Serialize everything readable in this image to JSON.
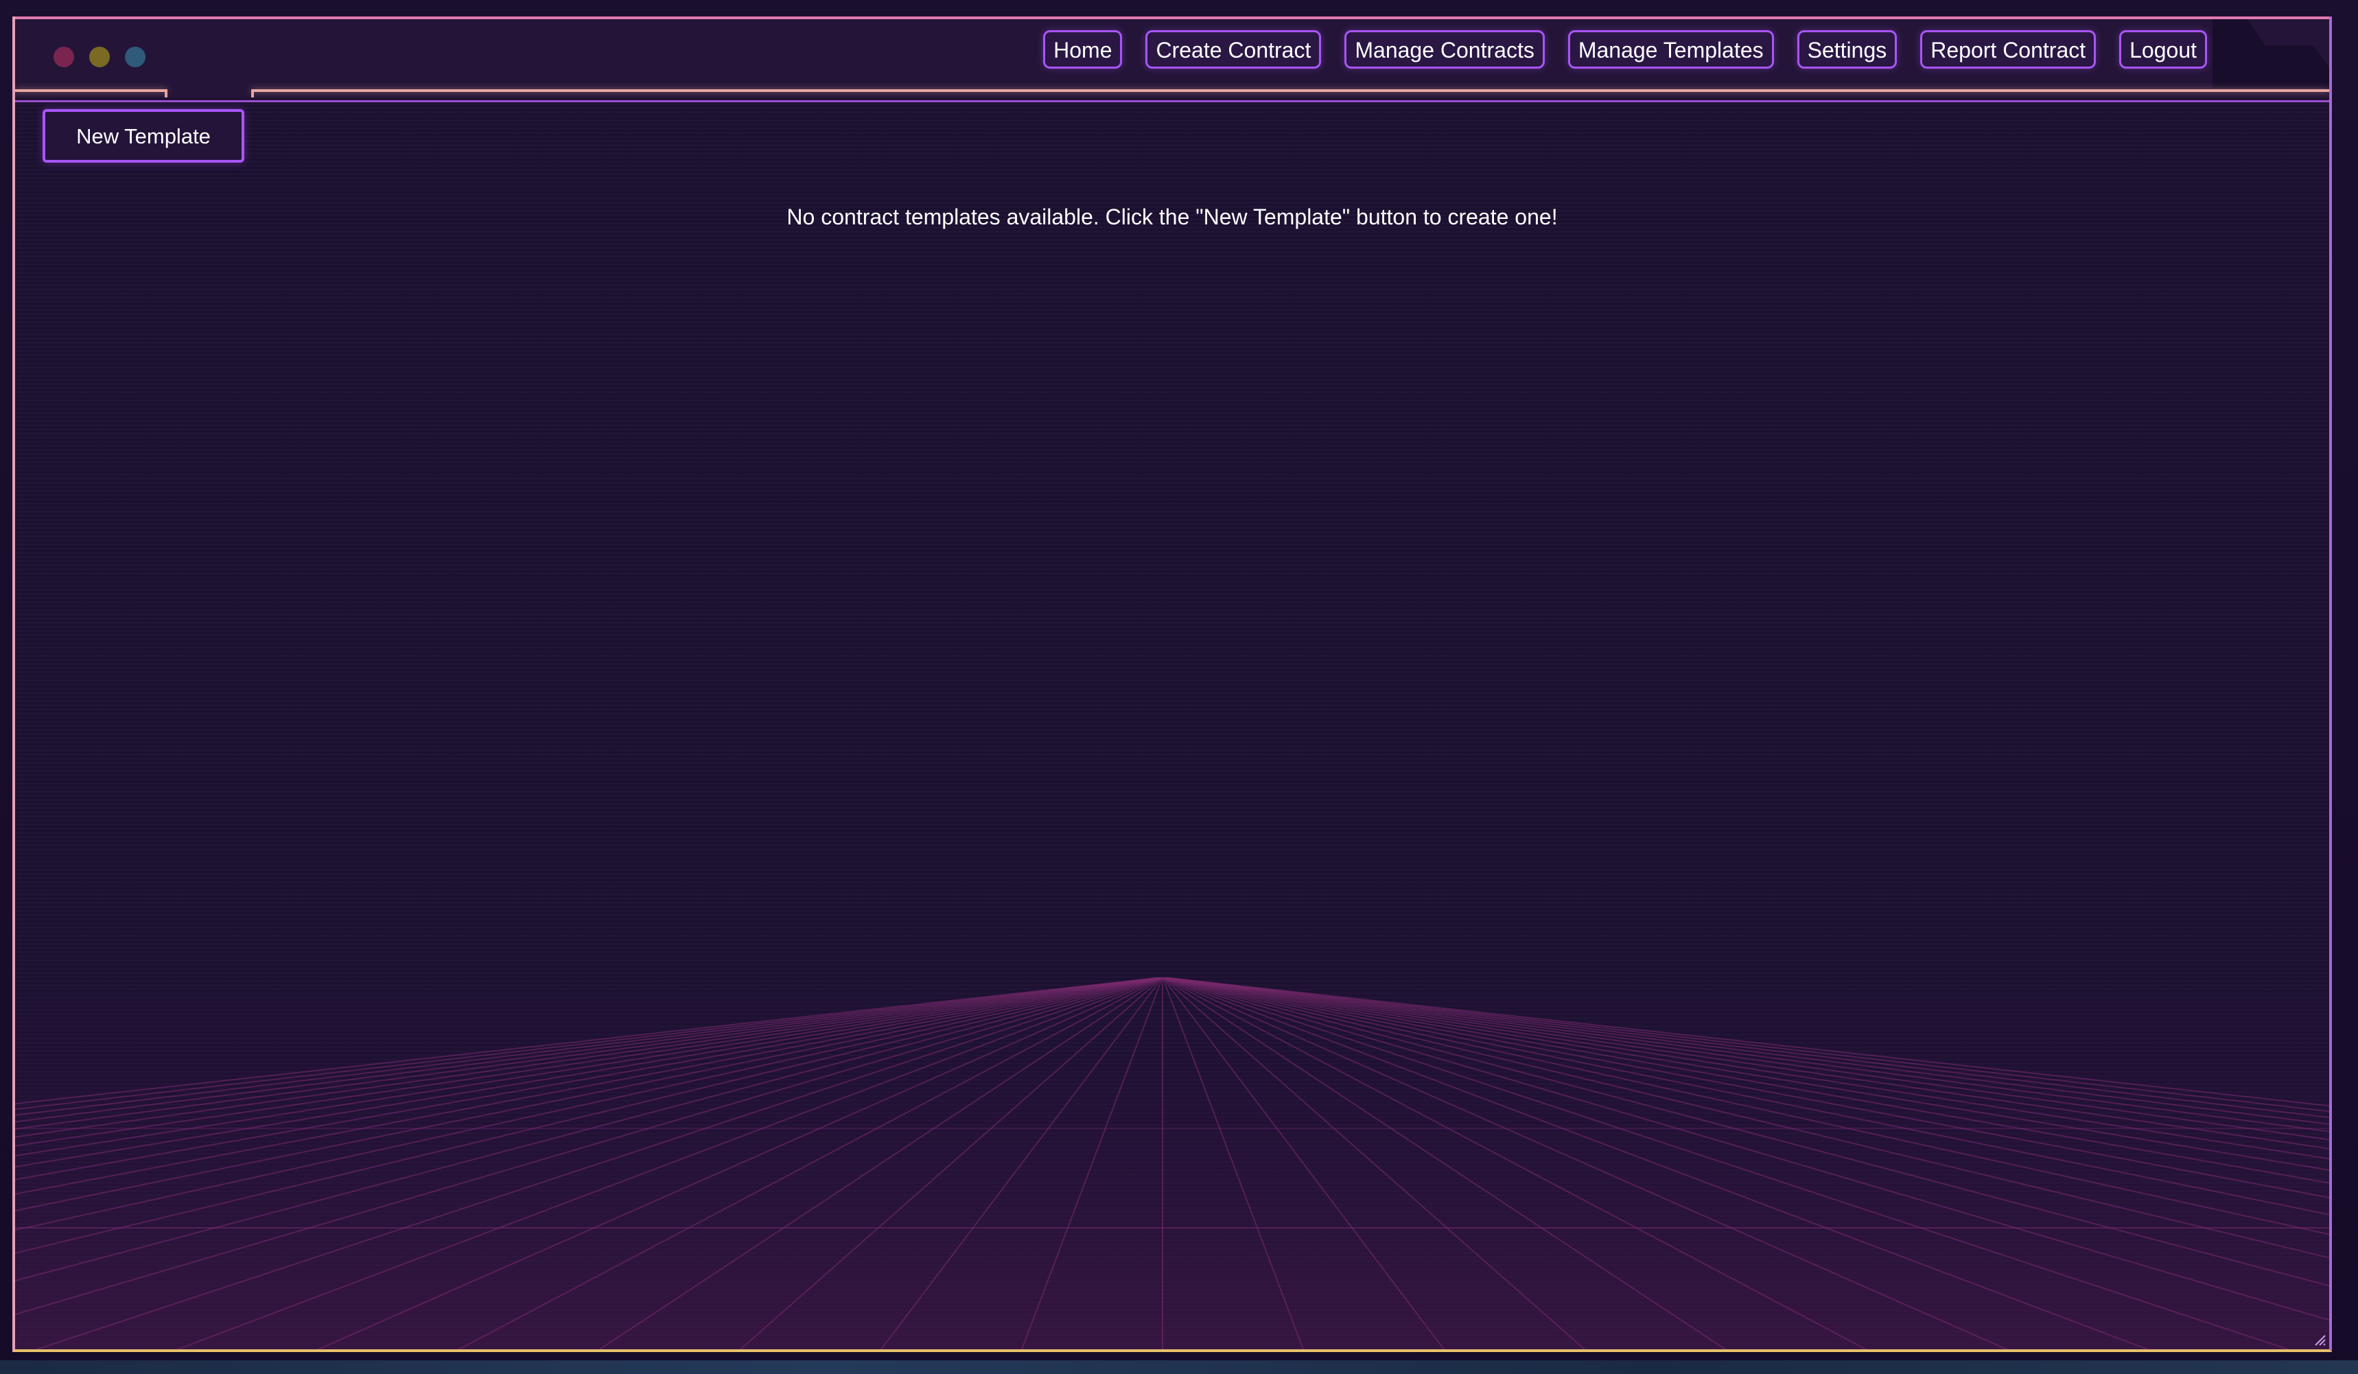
{
  "window": {
    "controls": [
      "close",
      "minimize",
      "zoom"
    ],
    "colors": {
      "background": "#1e1133",
      "accent": "#a855f7",
      "frame_left": "#e8a0b8",
      "frame_bottom": "#e8c26a",
      "frame_right": "#a56ad6",
      "grid": "#7a2a6e"
    }
  },
  "nav": {
    "items": [
      {
        "label": "Home"
      },
      {
        "label": "Create Contract"
      },
      {
        "label": "Manage Contracts"
      },
      {
        "label": "Manage Templates"
      },
      {
        "label": "Settings"
      },
      {
        "label": "Report Contract"
      },
      {
        "label": "Logout"
      }
    ]
  },
  "toolbar": {
    "new_template_label": "New Template"
  },
  "main": {
    "empty_message": "No contract templates available. Click the \"New Template\" button to create one!"
  }
}
